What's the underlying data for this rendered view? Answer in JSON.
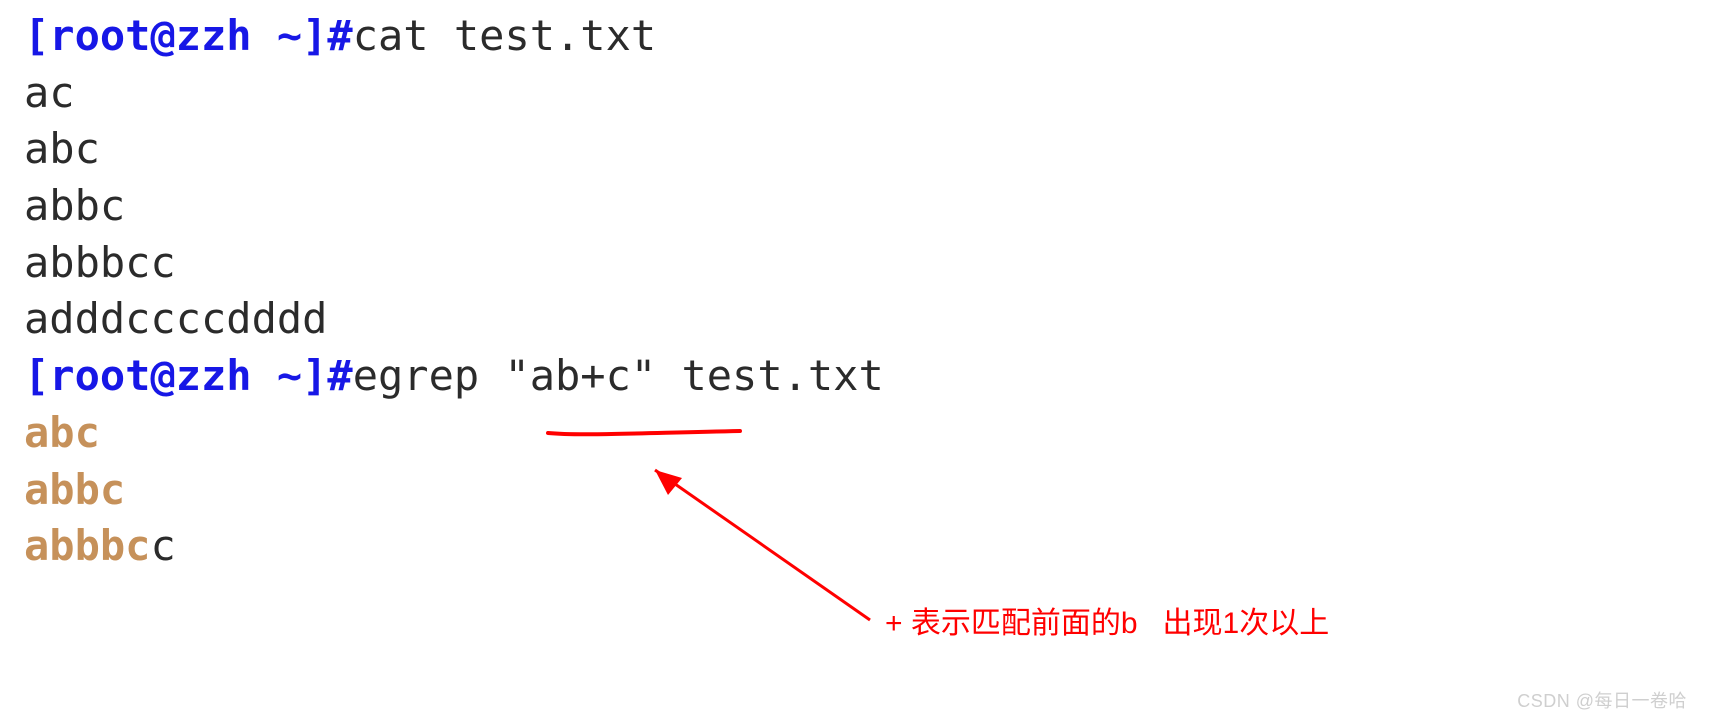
{
  "lines": {
    "prompt1_left": "[root@zzh ~]#",
    "prompt1_cmd": "cat test.txt",
    "file_lines": [
      "ac",
      "abc",
      "abbc",
      "abbbcc",
      "adddccccdddd"
    ],
    "prompt2_left": "[root@zzh ~]#",
    "prompt2_cmd": "egrep \"ab+c\" test.txt",
    "results": [
      {
        "match": "abc",
        "rest": ""
      },
      {
        "match": "abbc",
        "rest": ""
      },
      {
        "match": "abbbc",
        "rest": "c"
      }
    ]
  },
  "annotation": {
    "text": "+ 表示匹配前面的b   出现1次以上"
  },
  "watermark": "CSDN @每日一卷哈"
}
